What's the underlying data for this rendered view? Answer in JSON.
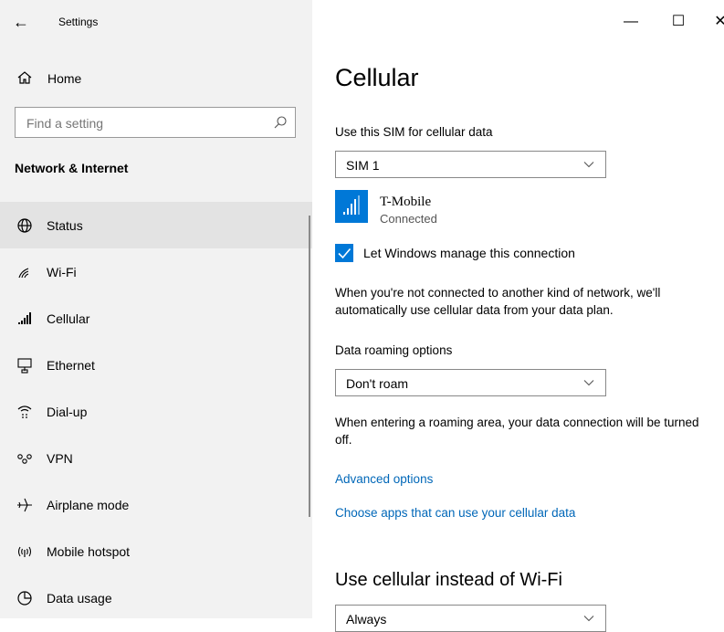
{
  "window": {
    "title": "Settings",
    "back_glyph": "←",
    "minimize_glyph": "—",
    "maximize_glyph": "☐",
    "close_glyph": "✕"
  },
  "sidebar": {
    "home_label": "Home",
    "search_placeholder": "Find a setting",
    "section_title": "Network & Internet",
    "items": [
      {
        "label": "Status",
        "icon": "globe-icon",
        "selected": true
      },
      {
        "label": "Wi-Fi",
        "icon": "wifi-icon"
      },
      {
        "label": "Cellular",
        "icon": "cellular-icon"
      },
      {
        "label": "Ethernet",
        "icon": "ethernet-icon"
      },
      {
        "label": "Dial-up",
        "icon": "dialup-icon"
      },
      {
        "label": "VPN",
        "icon": "vpn-icon"
      },
      {
        "label": "Airplane mode",
        "icon": "airplane-icon"
      },
      {
        "label": "Mobile hotspot",
        "icon": "hotspot-icon"
      },
      {
        "label": "Data usage",
        "icon": "data-usage-icon"
      }
    ]
  },
  "main": {
    "title": "Cellular",
    "sim_label": "Use this SIM for cellular data",
    "sim_value": "SIM 1",
    "network_name": "T-Mobile",
    "network_status": "Connected",
    "manage_label": "Let Windows manage this connection",
    "manage_checked": true,
    "manage_description": "When you're not connected to another kind of network, we'll automatically use cellular data from your data plan.",
    "roaming_label": "Data roaming options",
    "roaming_value": "Don't roam",
    "roaming_description": "When entering a roaming area, your data connection will be turned off.",
    "advanced_link": "Advanced options",
    "apps_link": "Choose apps that can use your cellular data",
    "wifi_section_title": "Use cellular instead of Wi-Fi",
    "wifi_select_value": "Always"
  },
  "colors": {
    "accent": "#0078d7",
    "link": "#0067b8",
    "sidebar_bg": "#f2f2f2",
    "selected_bg": "#e3e3e3"
  }
}
